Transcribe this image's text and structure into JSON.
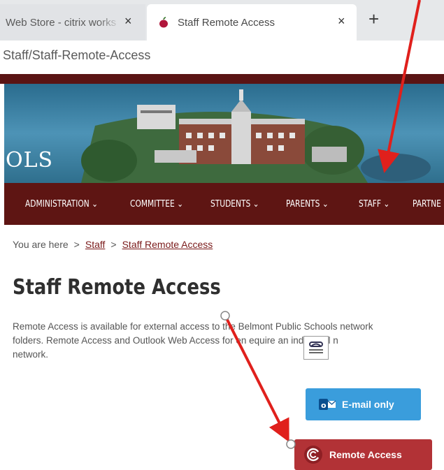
{
  "browser": {
    "tabs": [
      {
        "title": "Web Store - citrix works",
        "active": false
      },
      {
        "title": "Staff Remote Access",
        "active": true
      }
    ],
    "new_tab_label": "+",
    "close_label": "×",
    "url": "Staff/Staff-Remote-Access"
  },
  "banner": {
    "school_word": "OLS"
  },
  "nav": {
    "items": [
      {
        "label": "ADMINISTRATION ⌄"
      },
      {
        "label": "COMMITTEE ⌄"
      },
      {
        "label": "STUDENTS ⌄"
      },
      {
        "label": "PARENTS ⌄"
      },
      {
        "label": "STAFF ⌄"
      },
      {
        "label": "PARTNE"
      }
    ]
  },
  "breadcrumb": {
    "prefix": "You are here",
    "separator": ">",
    "links": [
      "Staff",
      "Staff Remote Access"
    ]
  },
  "page": {
    "title": "Staff Remote Access",
    "paragraph_lines": [
      "Remote Access is available for external access to the Belmont Public Schools network",
      "folders. Remote Access and Outlook Web Access for en      equire an individual n",
      "network."
    ]
  },
  "buttons": {
    "email_label": "E-mail only",
    "remote_label": "Remote Access"
  },
  "colors": {
    "nav_bg": "#5e1513",
    "email_button": "#3a9ddc",
    "remote_button": "#b23236",
    "annotation_arrow": "#e0201c"
  },
  "icons": {
    "tab_favicon": "apple-icon",
    "email_icon": "outlook-icon",
    "remote_icon": "citrix-icon"
  }
}
